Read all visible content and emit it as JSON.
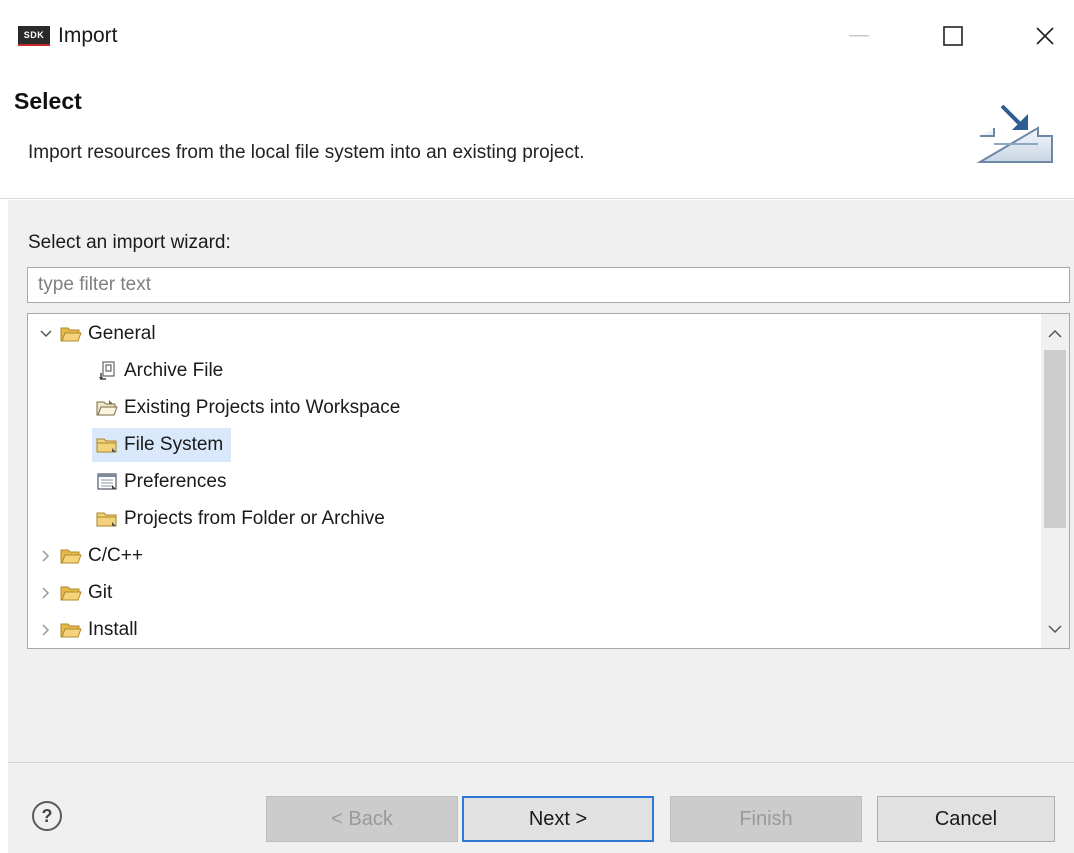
{
  "window": {
    "logo_text": "SDK",
    "title": "Import"
  },
  "banner": {
    "title": "Select",
    "description": "Import resources from the local file system into an existing project.",
    "icon": "import-wizard-icon"
  },
  "wizard": {
    "label": "Select an import wizard:",
    "filter_placeholder": "type filter text",
    "filter_value": ""
  },
  "tree": {
    "items": [
      {
        "label": "General",
        "expanded": true,
        "icon": "folder-icon"
      },
      {
        "label": "Archive File",
        "icon": "archive-file-icon"
      },
      {
        "label": "Existing Projects into Workspace",
        "icon": "existing-projects-icon"
      },
      {
        "label": "File System",
        "icon": "file-system-icon",
        "selected": true
      },
      {
        "label": "Preferences",
        "icon": "preferences-icon"
      },
      {
        "label": "Projects from Folder or Archive",
        "icon": "projects-folder-icon"
      },
      {
        "label": "C/C++",
        "expanded": false,
        "icon": "folder-icon"
      },
      {
        "label": "Git",
        "expanded": false,
        "icon": "folder-icon"
      },
      {
        "label": "Install",
        "expanded": false,
        "icon": "folder-icon"
      }
    ]
  },
  "buttons": {
    "back": "< Back",
    "next": "Next >",
    "finish": "Finish",
    "cancel": "Cancel"
  },
  "colors": {
    "selection": "#d9e9fb",
    "default_button_border": "#2d7ad6",
    "dialog_background": "#f0f0f0"
  }
}
